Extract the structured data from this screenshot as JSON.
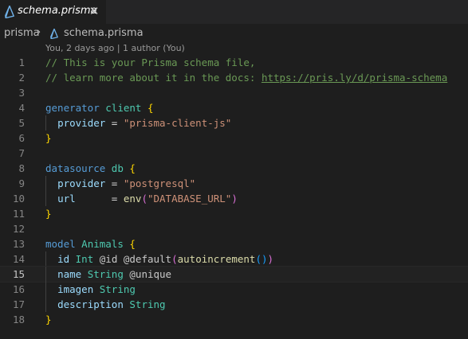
{
  "tab": {
    "label": "schema.prisma",
    "close_glyph": "✕"
  },
  "breadcrumb": {
    "root": "prisma",
    "separator": "›",
    "file": "schema.prisma"
  },
  "codelens": "You, 2 days ago | 1 author (You)",
  "current_line": 15,
  "lines": [
    {
      "n": "1",
      "tokens": [
        [
          "c-comment",
          "// This is your Prisma schema file,"
        ]
      ]
    },
    {
      "n": "2",
      "tokens": [
        [
          "c-comment",
          "// learn more about it in the docs: "
        ],
        [
          "c-link",
          "https://pris.ly/d/prisma-schema"
        ]
      ]
    },
    {
      "n": "3",
      "tokens": []
    },
    {
      "n": "4",
      "tokens": [
        [
          "c-kw",
          "generator"
        ],
        [
          "c-op",
          " "
        ],
        [
          "c-name",
          "client"
        ],
        [
          "c-op",
          " "
        ],
        [
          "c-brace",
          "{"
        ]
      ]
    },
    {
      "n": "5",
      "indent": true,
      "tokens": [
        [
          "c-op",
          "  "
        ],
        [
          "c-prop",
          "provider"
        ],
        [
          "c-op",
          " = "
        ],
        [
          "c-str",
          "\"prisma-client-js\""
        ]
      ]
    },
    {
      "n": "6",
      "tokens": [
        [
          "c-brace",
          "}"
        ]
      ]
    },
    {
      "n": "7",
      "tokens": []
    },
    {
      "n": "8",
      "tokens": [
        [
          "c-kw",
          "datasource"
        ],
        [
          "c-op",
          " "
        ],
        [
          "c-name",
          "db"
        ],
        [
          "c-op",
          " "
        ],
        [
          "c-brace",
          "{"
        ]
      ]
    },
    {
      "n": "9",
      "indent": true,
      "tokens": [
        [
          "c-op",
          "  "
        ],
        [
          "c-prop",
          "provider"
        ],
        [
          "c-op",
          " = "
        ],
        [
          "c-str",
          "\"postgresql\""
        ]
      ]
    },
    {
      "n": "10",
      "indent": true,
      "tokens": [
        [
          "c-op",
          "  "
        ],
        [
          "c-prop",
          "url"
        ],
        [
          "c-op",
          "      = "
        ],
        [
          "c-fn",
          "env"
        ],
        [
          "c-paren",
          "("
        ],
        [
          "c-str",
          "\"DATABASE_URL\""
        ],
        [
          "c-paren",
          ")"
        ]
      ]
    },
    {
      "n": "11",
      "tokens": [
        [
          "c-brace",
          "}"
        ]
      ]
    },
    {
      "n": "12",
      "tokens": []
    },
    {
      "n": "13",
      "tokens": [
        [
          "c-kw",
          "model"
        ],
        [
          "c-op",
          " "
        ],
        [
          "c-name",
          "Animals"
        ],
        [
          "c-op",
          " "
        ],
        [
          "c-brace",
          "{"
        ]
      ]
    },
    {
      "n": "14",
      "indent": true,
      "tokens": [
        [
          "c-op",
          "  "
        ],
        [
          "c-prop",
          "id"
        ],
        [
          "c-op",
          " "
        ],
        [
          "c-type",
          "Int"
        ],
        [
          "c-op",
          " "
        ],
        [
          "c-attr",
          "@id"
        ],
        [
          "c-op",
          " "
        ],
        [
          "c-attr",
          "@default"
        ],
        [
          "c-paren",
          "("
        ],
        [
          "c-fn",
          "autoincrement"
        ],
        [
          "c-paren2",
          "()"
        ],
        [
          "c-paren",
          ")"
        ]
      ]
    },
    {
      "n": "15",
      "indent": true,
      "tokens": [
        [
          "c-op",
          "  "
        ],
        [
          "c-prop",
          "name"
        ],
        [
          "c-op",
          " "
        ],
        [
          "c-type",
          "String"
        ],
        [
          "c-op",
          " "
        ],
        [
          "c-attr",
          "@unique"
        ]
      ]
    },
    {
      "n": "16",
      "indent": true,
      "tokens": [
        [
          "c-op",
          "  "
        ],
        [
          "c-prop",
          "imagen"
        ],
        [
          "c-op",
          " "
        ],
        [
          "c-type",
          "String"
        ]
      ]
    },
    {
      "n": "17",
      "indent": true,
      "tokens": [
        [
          "c-op",
          "  "
        ],
        [
          "c-prop",
          "description"
        ],
        [
          "c-op",
          " "
        ],
        [
          "c-type",
          "String"
        ]
      ]
    },
    {
      "n": "18",
      "tokens": [
        [
          "c-brace",
          "}"
        ]
      ]
    }
  ],
  "colors": {
    "editor_bg": "#1e1e1e",
    "tabbar_bg": "#252526",
    "comment": "#6a9955",
    "keyword": "#569cd6",
    "type": "#4ec9b0",
    "string": "#ce9178",
    "property": "#9cdcfe",
    "brace": "#ffd700"
  },
  "icons": {
    "tab_icon": "prisma-icon",
    "close_icon": "close-icon",
    "breadcrumb_icon": "prisma-icon"
  }
}
